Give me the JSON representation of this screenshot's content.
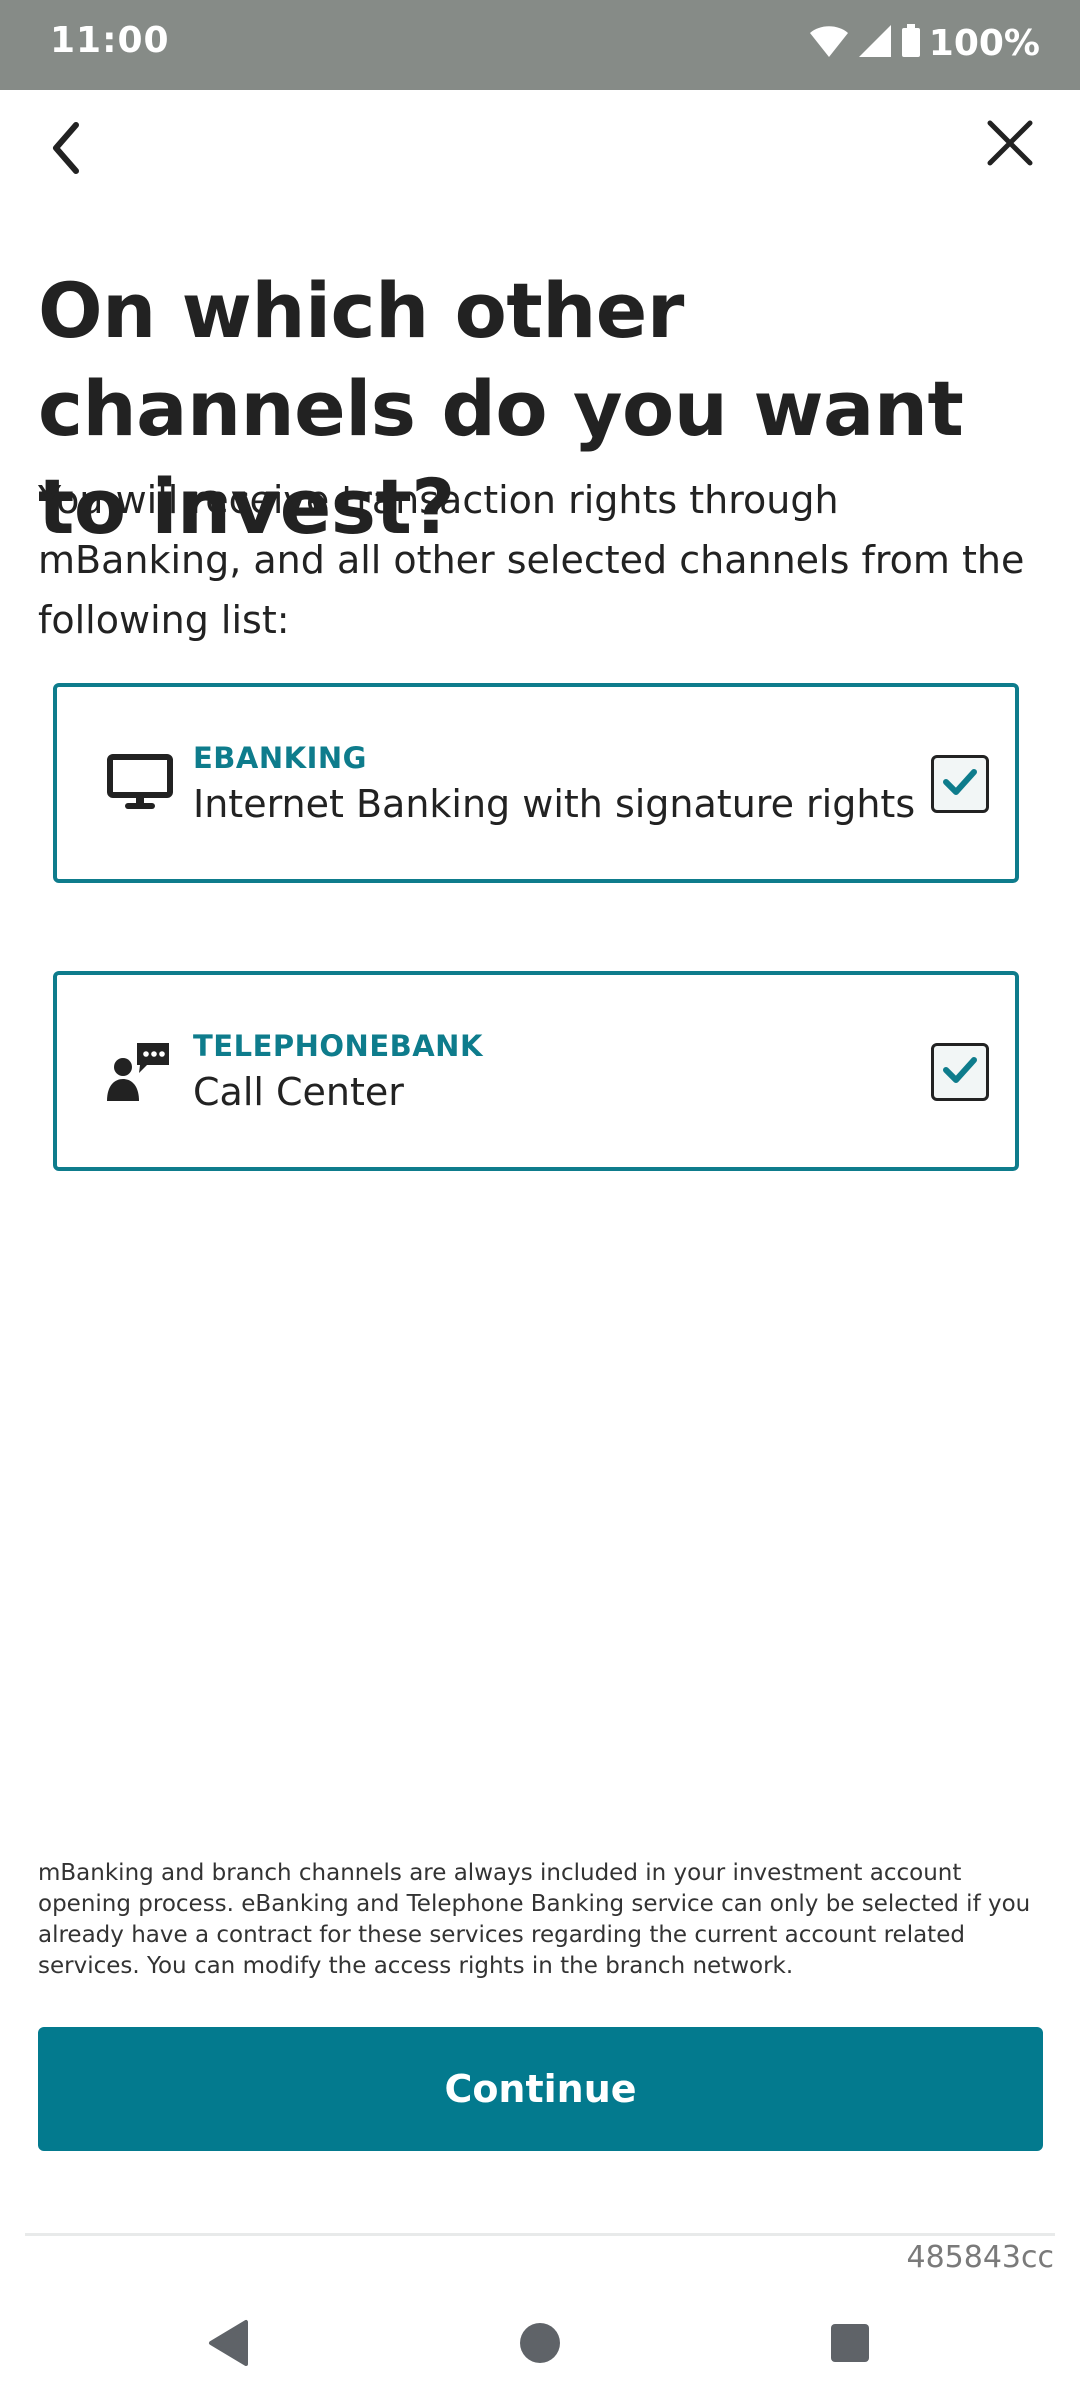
{
  "status_bar": {
    "time": "11:00",
    "battery": "100%"
  },
  "nav": {
    "back_icon": "chevron-left-icon",
    "close_icon": "close-icon"
  },
  "header": {
    "title": "On which other channels do you want to invest?",
    "subtitle": "You will receive transaction rights through mBanking, and all other selected channels from the following list:"
  },
  "options": [
    {
      "kicker": "EBANKING",
      "label": "Internet Banking with signature rights",
      "icon": "monitor-icon",
      "checked": true
    },
    {
      "kicker": "TELEPHONEBANK",
      "label": "Call Center",
      "icon": "person-chat-icon",
      "checked": true
    }
  ],
  "disclaimer": "mBanking and branch channels are always included in your investment account opening process. eBanking and Telephone Banking service can only be selected if you already have a contract for these services regarding the current account related services. You can modify the access rights in the branch network.",
  "actions": {
    "continue_label": "Continue"
  },
  "footer": {
    "build_id": "485843cc"
  },
  "colors": {
    "accent": "#037a8e",
    "card_border": "#0e7c8c",
    "status_bar": "#868b87",
    "text": "#222222"
  }
}
